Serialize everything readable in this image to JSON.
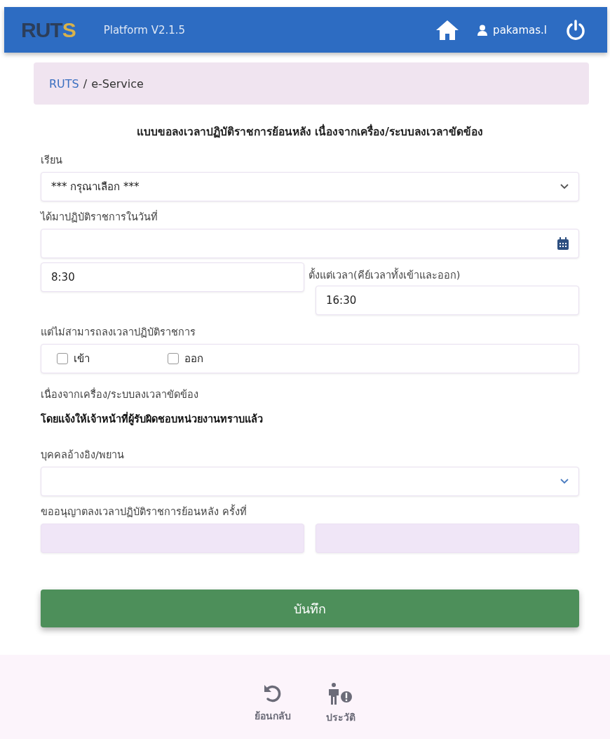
{
  "header": {
    "logo": {
      "text": "RUT",
      "accent": "S"
    },
    "platform": "Platform V2.1.5",
    "user": "pakamas.l"
  },
  "breadcrumb": {
    "root": "RUTS",
    "separator": "/",
    "current": "e-Service"
  },
  "form": {
    "title": "แบบขอลงเวลาปฏิบัติราชการย้อนหลัง เนื่องจากเครื่อง/ระบบลงเวลาขัดข้อง",
    "fields": [
      {
        "kind": "select",
        "label": "เรียน",
        "value": "*** กรุณาเลือก ***"
      },
      {
        "kind": "date",
        "label": "ได้มาปฏิบัติราชการในวันที่"
      },
      {
        "kind": "timepair",
        "label": "ตั้งแต่เวลา(คีย์เวลาทั้งเข้าและออก)",
        "start": "8:30",
        "end": "16:30"
      },
      {
        "kind": "checks",
        "label": "แต่ไม่สามารถลงเวลาปฏิบัติราชการ",
        "options": [
          {
            "label": "เข้า",
            "checked": false
          },
          {
            "label": "ออก",
            "checked": false
          }
        ]
      },
      {
        "kind": "note",
        "lines": [
          {
            "text": "เนื่องจากเครื่อง/ระบบลงเวลาขัดข้อง",
            "strong": false
          },
          {
            "text": "โดยแจ้งให้เจ้าหน้าที่ผู้รับผิดชอบหน่วยงานทราบแล้ว",
            "strong": true
          }
        ]
      },
      {
        "kind": "select",
        "label": "บุคคลอ้างอิง/พยาน"
      },
      {
        "kind": "readonlypair",
        "label": "ขออนุญาตลงเวลาปฏิบัติราชการย้อนหลัง ครั้งที่"
      }
    ],
    "submit": "บันทึก"
  },
  "footer": [
    {
      "kind": "back",
      "label": "ย้อนกลับ"
    },
    {
      "kind": "history",
      "label": "ประวัติ"
    }
  ]
}
